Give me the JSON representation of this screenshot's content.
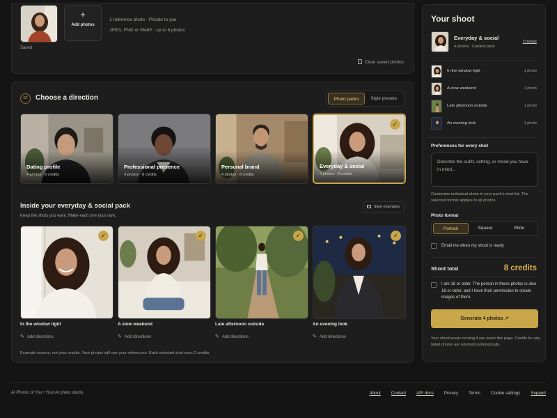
{
  "upload": {
    "saved_label": "Saved",
    "add_photo_label": "Add photos",
    "add_icon": "+",
    "info_line_1": "1 reference photo · Private to you",
    "info_line_2": "JPEG, PNG or WebP · up to 8 photos",
    "clear_label": "Clear saved photos"
  },
  "direction": {
    "step": "02",
    "title": "Choose a direction",
    "tabs": [
      {
        "label": "Photo packs",
        "active": true
      },
      {
        "label": "Style presets",
        "active": false
      }
    ],
    "packs": [
      {
        "name": "Dating profile",
        "meta": "4 photos · 8 credits",
        "selected": false
      },
      {
        "name": "Professional presence",
        "meta": "4 photos · 8 credits",
        "selected": false
      },
      {
        "name": "Personal brand",
        "meta": "4 photos · 8 credits",
        "selected": false
      },
      {
        "name": "Everyday & social",
        "meta": "4 photos · 8 credits",
        "selected": true
      }
    ],
    "inside_title": "Inside your everyday & social pack",
    "inside_sub": "Keep the shots you want. Make each one your own.",
    "style_examples": "Style examples",
    "shots": [
      {
        "name": "In the window light",
        "action": "Add directions",
        "selected": true
      },
      {
        "name": "A slow weekend",
        "action": "Add directions",
        "selected": true
      },
      {
        "name": "Late afternoon outside",
        "action": "Add directions",
        "selected": true
      },
      {
        "name": "An evening look",
        "action": "Add directions",
        "selected": true
      }
    ],
    "footnote": "Example scenes, not your results. Your photos will use your references. Each selected shot uses 2 credits."
  },
  "sidebar": {
    "title": "Your shoot",
    "pack_name": "Everyday & social",
    "pack_meta": "4 photos · Curated pack",
    "change": "Change",
    "shots": [
      {
        "name": "In the window light",
        "count": "1 photo"
      },
      {
        "name": "A slow weekend",
        "count": "1 photo"
      },
      {
        "name": "Late afternoon outside",
        "count": "1 photo"
      },
      {
        "name": "An evening look",
        "count": "1 photo"
      }
    ],
    "pref_label": "Preferences for every shot",
    "pref_placeholder": "Describe the outfit, setting, or mood you have in mind...",
    "pref_help": "Customize individual shots in your pack's shot list. The selected format applies to all photos.",
    "format_label": "Photo format",
    "formats": [
      {
        "label": "Portrait",
        "active": true
      },
      {
        "label": "Square",
        "active": false
      },
      {
        "label": "Wide",
        "active": false
      }
    ],
    "email_label": "Email me when my shoot is ready",
    "total_label": "Shoot total",
    "total_value": "8 credits",
    "consent": "I am 18 or older. The person in these photos is also 18 or older, and I have their permission to create images of them.",
    "generate_label": "Generate 4 photos ↗",
    "run_note": "Your shoot keeps running if you leave this page. Credits for any failed photos are returned automatically."
  },
  "footer": {
    "brand": "AI Photos of You • Your AI photo studio.",
    "links": [
      {
        "label": "About",
        "underline": true
      },
      {
        "label": "Contact",
        "underline": true
      },
      {
        "label": "API docs",
        "underline": true
      },
      {
        "label": "Privacy",
        "underline": false
      },
      {
        "label": "Terms",
        "underline": false
      },
      {
        "label": "Cookie settings",
        "underline": false
      },
      {
        "label": "Support",
        "underline": true
      }
    ]
  },
  "colors": {
    "accent": "#c9a64a",
    "background": "#141414",
    "card": "#1d1d1d"
  },
  "icons": {
    "check": "checkmark-icon",
    "trash": "trash-icon",
    "pencil": "pencil-icon",
    "image": "image-icon"
  }
}
